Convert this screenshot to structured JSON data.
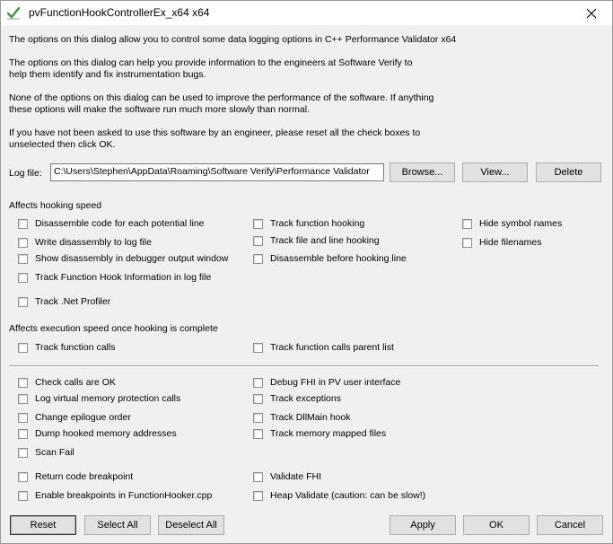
{
  "window": {
    "title": "pvFunctionHookControllerEx_x64 x64",
    "app_icon": "checkmark-icon",
    "close_icon": "close-icon"
  },
  "intro": {
    "p1": "The options on this dialog allow you to control some data logging options in C++ Performance Validator x64",
    "p2_line1": "The options on this dialog can help you provide information to the engineers at Software Verify to",
    "p2_line2": "help them identify and fix instrumentation bugs.",
    "p3_line1": "None of the options on this dialog can be used to improve the performance of the software. If anything",
    "p3_line2": "these options will make the software run much more slowly than normal.",
    "p4_line1": "If you have not been asked to use this software by an engineer, please reset all the check boxes to",
    "p4_line2": "unselected then click OK."
  },
  "logfile": {
    "label": "Log file:",
    "value": "C:\\Users\\Stephen\\AppData\\Roaming\\Software Verify\\Performance Validator",
    "browse": "Browse...",
    "view": "View...",
    "delete": "Delete"
  },
  "hooking": {
    "heading": "Affects hooking speed",
    "options": [
      {
        "label": "Disassemble code for each potential line",
        "checked": false
      },
      {
        "label": "Write disassembly to log file",
        "checked": false
      },
      {
        "label": "Show disassembly in debugger output window",
        "checked": false
      },
      {
        "label": "Track Function Hook Information in log file",
        "checked": false
      },
      {
        "label": "Track .Net Profiler",
        "checked": false
      },
      {
        "label": "Track function hooking",
        "checked": false
      },
      {
        "label": "Track file and line hooking",
        "checked": false
      },
      {
        "label": "Disassemble before hooking line",
        "checked": false
      },
      {
        "label": "Hide symbol names",
        "checked": false
      },
      {
        "label": "Hide filenames",
        "checked": false
      }
    ]
  },
  "execution": {
    "heading": "Affects execution speed once hooking is complete",
    "options": [
      {
        "label": "Track function calls",
        "checked": false
      },
      {
        "label": "Track function calls parent list",
        "checked": false
      }
    ]
  },
  "debug": {
    "options": [
      {
        "label": "Check calls are OK",
        "checked": false
      },
      {
        "label": "Log virtual memory protection calls",
        "checked": false
      },
      {
        "label": "Change epilogue order",
        "checked": false
      },
      {
        "label": "Dump hooked memory addresses",
        "checked": false
      },
      {
        "label": "Scan Fail",
        "checked": false
      },
      {
        "label": "Return code breakpoint",
        "checked": false
      },
      {
        "label": "Enable breakpoints in FunctionHooker.cpp",
        "checked": false
      },
      {
        "label": "Debug FHI in PV user interface",
        "checked": false
      },
      {
        "label": "Track exceptions",
        "checked": false
      },
      {
        "label": "Track DllMain hook",
        "checked": false
      },
      {
        "label": "Track memory mapped files",
        "checked": false
      },
      {
        "label": "Validate FHI",
        "checked": false
      },
      {
        "label": "Heap Validate (caution: can be slow!)",
        "checked": false
      }
    ]
  },
  "buttons": {
    "reset": "Reset",
    "select_all": "Select All",
    "deselect_all": "Deselect All",
    "apply": "Apply",
    "ok": "OK",
    "cancel": "Cancel"
  }
}
